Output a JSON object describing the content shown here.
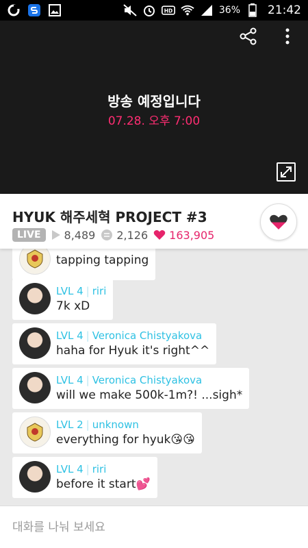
{
  "status_bar": {
    "battery_percent": "36%",
    "time": "21:42"
  },
  "video": {
    "title": "방송 예정입니다",
    "schedule": "07.28. 오후 7:00"
  },
  "broadcast": {
    "title": "HYUK 해주세혁 PROJECT #3",
    "live_label": "LIVE",
    "views": "8,489",
    "comments": "2,126",
    "likes": "163,905"
  },
  "chat": {
    "messages": [
      {
        "level": "",
        "user": "",
        "text": "tapping tapping",
        "avatar": "crest-icon"
      },
      {
        "level": "LVL 4",
        "user": "riri",
        "text": "7k xD",
        "avatar": "user-photo"
      },
      {
        "level": "LVL 4",
        "user": "Veronica Chistyakova",
        "text": "haha for Hyuk it's right^^",
        "avatar": "user-photo"
      },
      {
        "level": "LVL 4",
        "user": "Veronica Chistyakova",
        "text": "will we make 500k-1m?! ...sigh*",
        "avatar": "user-photo"
      },
      {
        "level": "LVL 2",
        "user": "unknown",
        "text": "everything for hyuk😘😘",
        "avatar": "crest-icon"
      },
      {
        "level": "LVL 4",
        "user": "riri",
        "text": "before it start💕",
        "avatar": "user-photo"
      }
    ]
  },
  "input": {
    "placeholder": "대화를 나눠 보세요"
  },
  "colors": {
    "accent_pink": "#e6246b",
    "schedule_pink": "#ff2d72",
    "user_blue": "#2ec1e3"
  }
}
